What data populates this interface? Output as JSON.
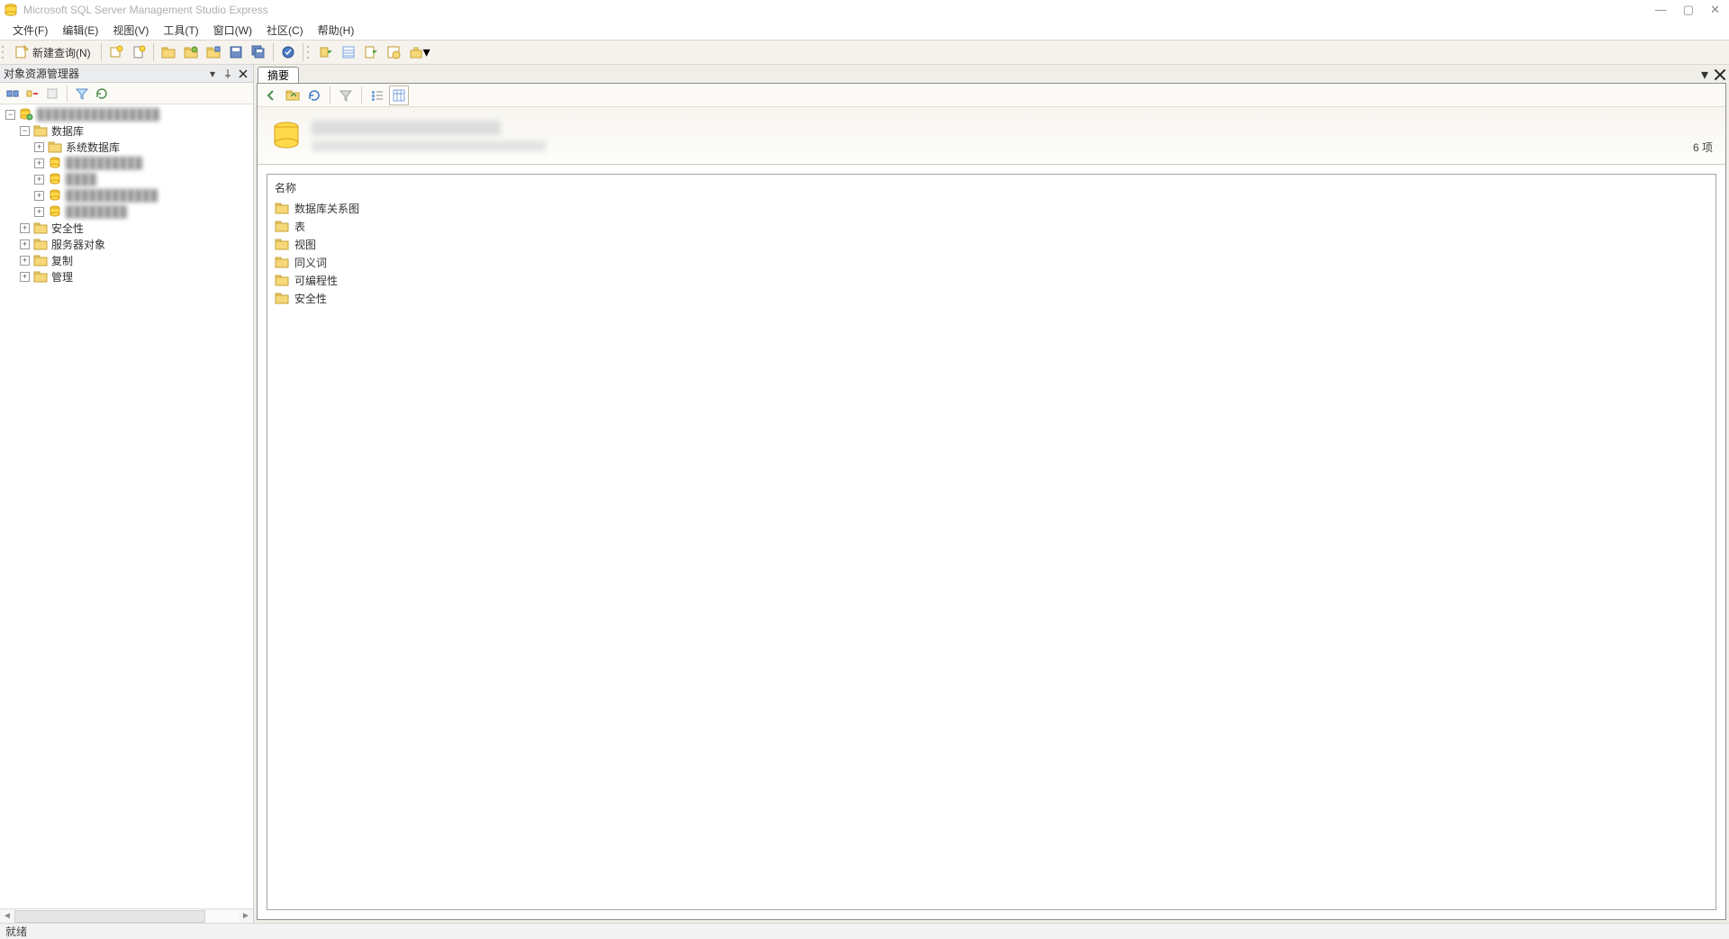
{
  "titlebar": {
    "app_title": "Microsoft SQL Server Management Studio Express",
    "minimize_glyph": "—",
    "maximize_glyph": "▢",
    "close_glyph": "✕"
  },
  "menu": {
    "file": "文件(F)",
    "edit": "编辑(E)",
    "view": "视图(V)",
    "tools": "工具(T)",
    "window": "窗口(W)",
    "community": "社区(C)",
    "help": "帮助(H)"
  },
  "toolbar": {
    "new_query": "新建查询(N)"
  },
  "object_explorer": {
    "title": "对象资源管理器",
    "tree": {
      "root_redacted": "████████████████",
      "databases": "数据库",
      "system_databases": "系统数据库",
      "db_redacted_1": "██████████",
      "db_redacted_2": "████",
      "db_redacted_3": "████████████",
      "db_redacted_4": "████████",
      "security": "安全性",
      "server_objects": "服务器对象",
      "replication": "复制",
      "management": "管理"
    }
  },
  "summary": {
    "tab_label": "摘要",
    "item_count_label": "6 项",
    "column_name": "名称",
    "items": [
      "数据库关系图",
      "表",
      "视图",
      "同义词",
      "可编程性",
      "安全性"
    ]
  },
  "statusbar": {
    "ready": "就绪"
  }
}
